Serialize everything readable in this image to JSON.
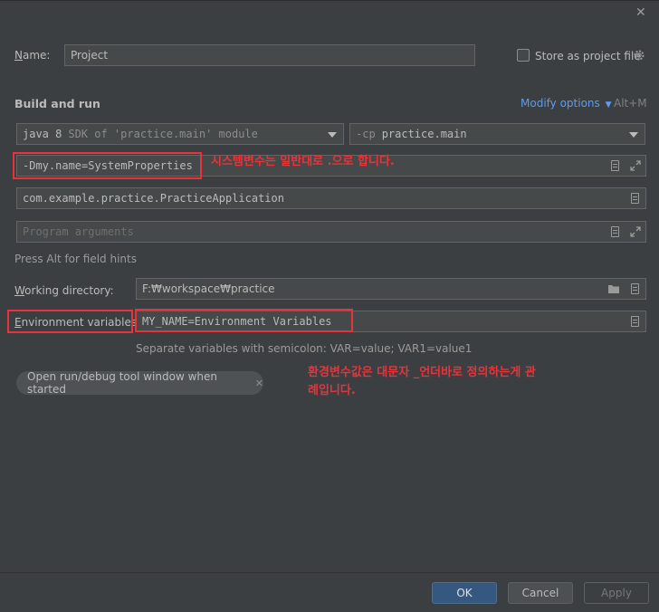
{
  "dialog": {
    "close_glyph": "✕"
  },
  "name_row": {
    "label_prefix": "",
    "label_mnemonic": "N",
    "label_rest": "ame:",
    "value": "Project",
    "store_label": "Store as project file"
  },
  "build_run": {
    "section_title": "Build and run",
    "modify_options": "Modify options",
    "modify_shortcut": "Alt+M",
    "sdk_primary": "java 8",
    "sdk_secondary": "SDK of 'practice.main' module",
    "cp_prefix": "-cp",
    "cp_value": "practice.main",
    "vm_options": "-Dmy.name=SystemProperties",
    "main_class": "com.example.practice.PracticeApplication",
    "program_args_placeholder": "Program arguments",
    "hint": "Press Alt for field hints"
  },
  "working_dir": {
    "label_mnemonic": "W",
    "label_rest": "orking directory:",
    "value": "F:₩workspace₩practice"
  },
  "env_vars": {
    "label_mnemonic": "E",
    "label_rest": "nvironment variables:",
    "value": "MY_NAME=Environment Variables",
    "hint": "Separate variables with semicolon: VAR=value; VAR1=value1"
  },
  "tool_window_chip": {
    "label": "Open run/debug tool window when started",
    "close_glyph": "✕"
  },
  "annotations": {
    "system_props_note": "시스템변수는 일반대로 .으로 합니다.",
    "env_note_line1": "환경변수값은 대문자 _언더바로 정의하는게 관",
    "env_note_line2": "례입니다."
  },
  "footer": {
    "ok": "OK",
    "cancel": "Cancel",
    "apply": "Apply"
  },
  "colors": {
    "background": "#3c3f41",
    "accent_link": "#589df6",
    "ok_button": "#365880",
    "annotation_red": "#e8333a"
  }
}
